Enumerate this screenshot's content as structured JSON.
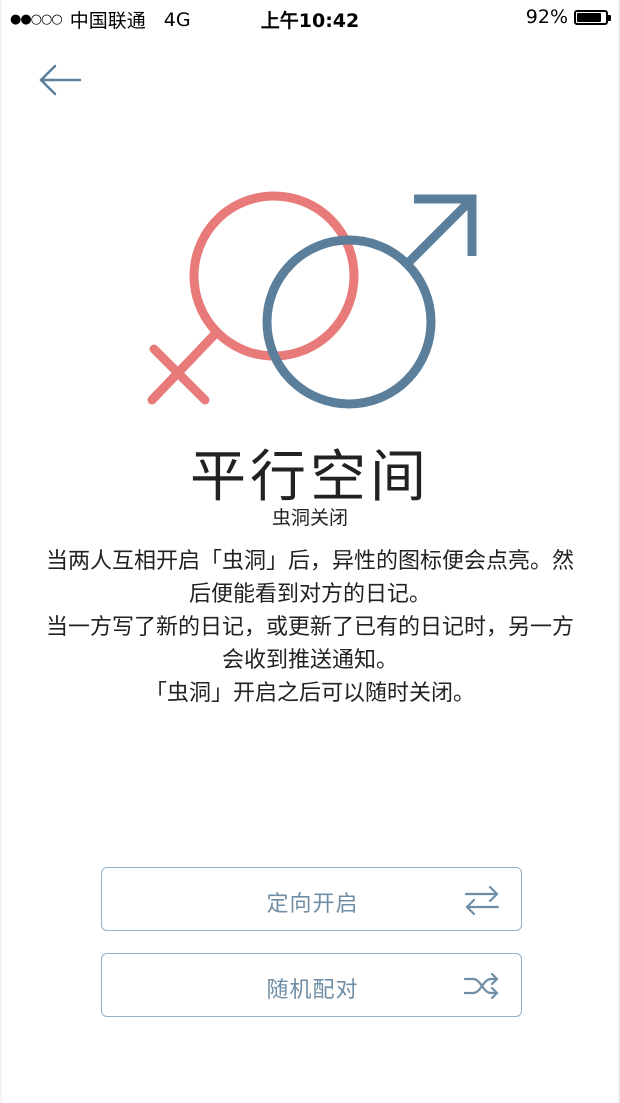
{
  "status_bar": {
    "signal": "●●○○○",
    "carrier": "中国联通",
    "network": "4G",
    "time": "上午10:42",
    "battery_percent": "92%",
    "battery_level": 0.92
  },
  "nav": {
    "back_icon": "arrow-left-icon"
  },
  "symbol": {
    "icon": "venus-mars-icon",
    "female_color": "#e87a7a",
    "male_color": "#5b7f9b"
  },
  "header": {
    "title": "平行空间",
    "subtitle": "虫洞关闭"
  },
  "description": {
    "lines": [
      "当两人互相开启「虫洞」后，异性的图标便会点亮。然后便能看到对方的日记。",
      "当一方写了新的日记，或更新了已有的日记时，另一方会收到推送通知。",
      "「虫洞」开启之后可以随时关闭。"
    ]
  },
  "actions": {
    "directed": {
      "label": "定向开启",
      "icon": "swap-arrows-icon"
    },
    "random": {
      "label": "随机配对",
      "icon": "shuffle-icon"
    }
  },
  "colors": {
    "accent": "#6f8ea5",
    "button_border": "#8fb1c9"
  }
}
